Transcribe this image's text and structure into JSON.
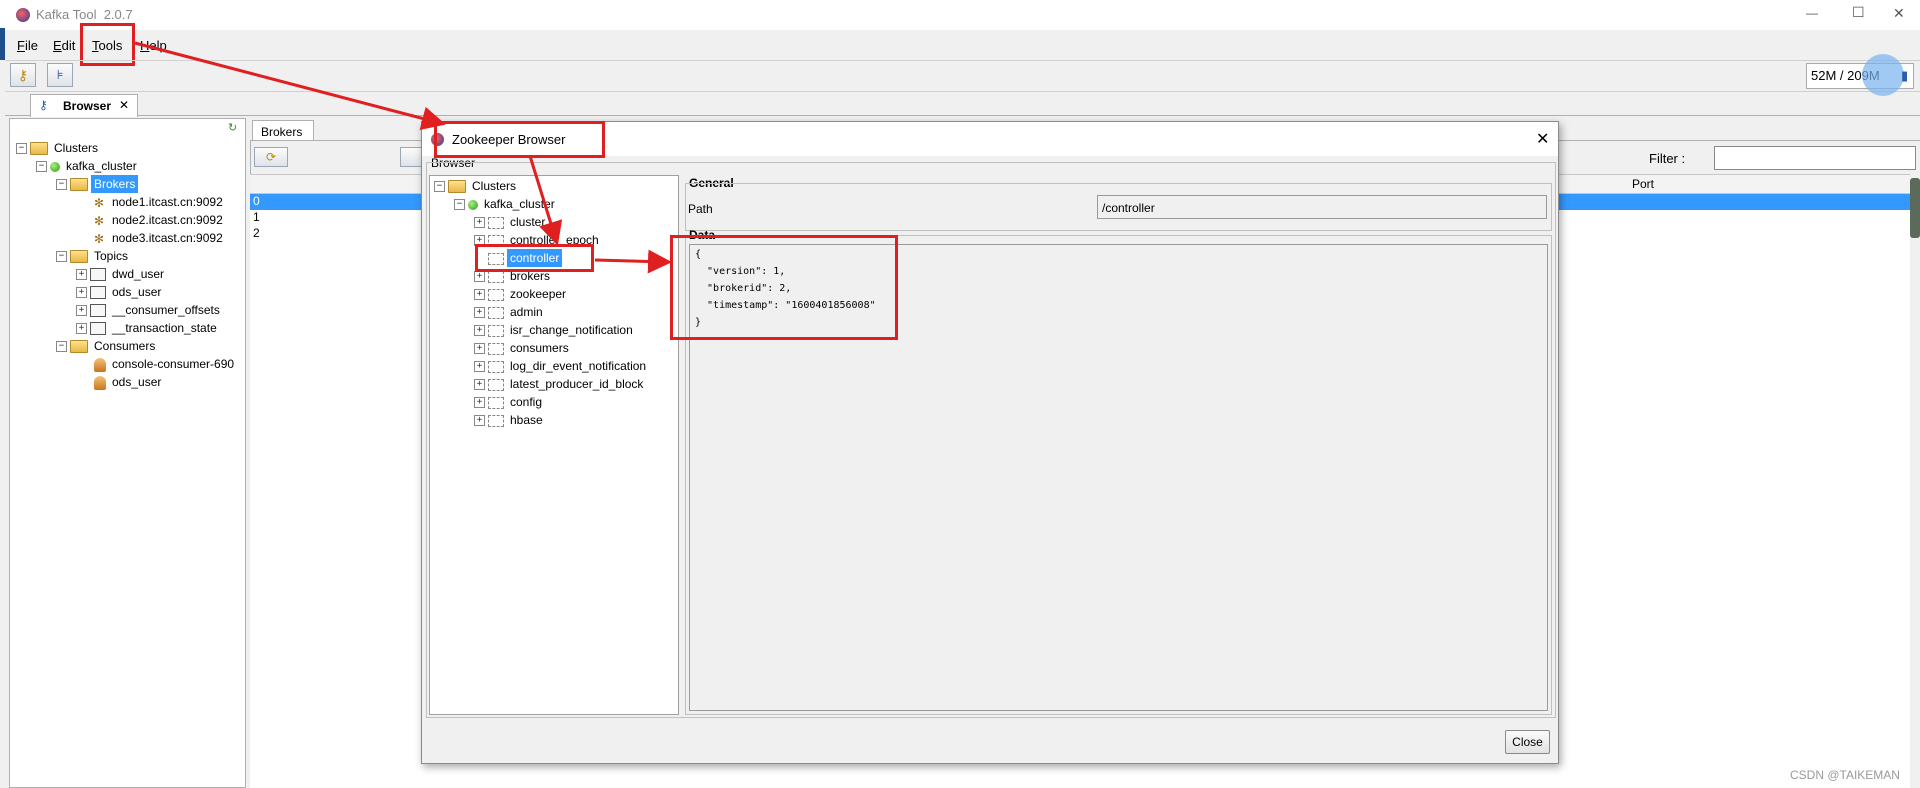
{
  "window": {
    "title": "Kafka Tool  2.0.7",
    "minimize": "—",
    "maximize": "☐",
    "close": "✕"
  },
  "menu": [
    {
      "key": "F",
      "rest": "ile"
    },
    {
      "key": "E",
      "rest": "dit"
    },
    {
      "key": "T",
      "rest": "ools"
    },
    {
      "key": "H",
      "rest": "elp"
    }
  ],
  "memory": "52M / 209M",
  "main_tab": {
    "label": "Browser",
    "close": "✕"
  },
  "left_tree": {
    "clusters": "Clusters",
    "cluster": "kafka_cluster",
    "brokers": "Brokers",
    "nodes": [
      "node1.itcast.cn:9092",
      "node2.itcast.cn:9092",
      "node3.itcast.cn:9092"
    ],
    "topics": "Topics",
    "topic_items": [
      "dwd_user",
      "ods_user",
      "__consumer_offsets",
      "__transaction_state"
    ],
    "consumers": "Consumers",
    "consumer_items": [
      "console-consumer-690",
      "ods_user"
    ]
  },
  "brokers_panel": {
    "tab": "Brokers",
    "filter_label": "Filter :",
    "filter_value": "",
    "column_port": "Port",
    "rows": [
      "0",
      "1",
      "2"
    ]
  },
  "zk_dialog": {
    "title": "Zookeeper Browser",
    "close": "✕",
    "browser_label": "Browser",
    "tree": {
      "root": "Clusters",
      "cluster": "kafka_cluster",
      "nodes": [
        "cluster",
        "controller_epoch",
        "controller",
        "brokers",
        "zookeeper",
        "admin",
        "isr_change_notification",
        "consumers",
        "log_dir_event_notification",
        "latest_producer_id_block",
        "config",
        "hbase"
      ],
      "selected": "controller"
    },
    "general_label": "General",
    "path_label": "Path",
    "path_value": "/controller",
    "data_label": "Data",
    "data_lines": [
      "{",
      "  \"version\": 1,",
      "  \"brokerid\": 2,",
      "  \"timestamp\": \"1600401856008\"",
      "}"
    ],
    "close_button": "Close"
  },
  "watermark": "CSDN @TAIKEMAN"
}
